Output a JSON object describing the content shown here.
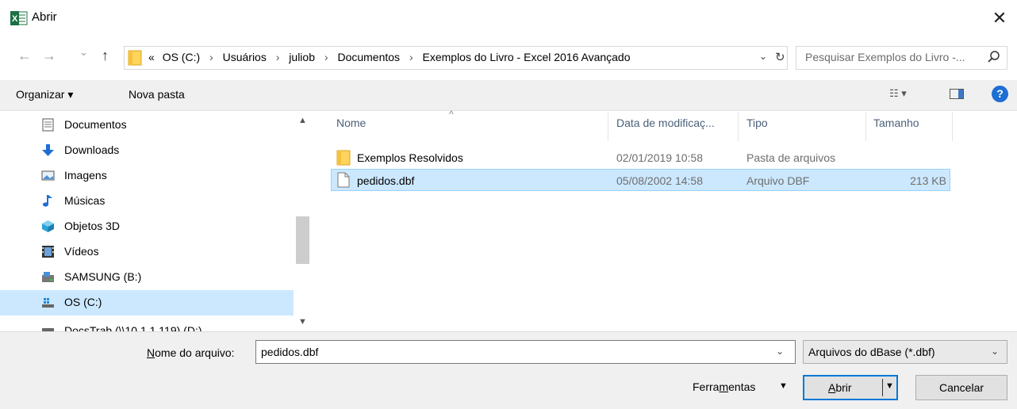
{
  "window": {
    "title": "Abrir",
    "close": "✕"
  },
  "nav": {
    "back": "←",
    "forward": "→",
    "recent": "⌄",
    "up": "↑"
  },
  "address": {
    "prefix": "«",
    "crumbs": [
      "OS (C:)",
      "Usuários",
      "juliob",
      "Documentos",
      "Exemplos do Livro - Excel 2016 Avançado"
    ],
    "separator": "›",
    "dropdown": "⌄",
    "refresh": "↻"
  },
  "search": {
    "placeholder": "Pesquisar Exemplos do Livro -..."
  },
  "toolbar": {
    "organize": "Organizar ▾",
    "new_folder": "Nova pasta",
    "view": "☷ ▾",
    "help": "?"
  },
  "sidebar": {
    "items": [
      {
        "label": "Documentos",
        "icon": "document-icon"
      },
      {
        "label": "Downloads",
        "icon": "download-icon"
      },
      {
        "label": "Imagens",
        "icon": "pictures-icon"
      },
      {
        "label": "Músicas",
        "icon": "music-icon"
      },
      {
        "label": "Objetos 3D",
        "icon": "cube-icon"
      },
      {
        "label": "Vídeos",
        "icon": "video-icon"
      },
      {
        "label": "SAMSUNG (B:)",
        "icon": "usb-drive-icon"
      },
      {
        "label": "OS (C:)",
        "icon": "windows-drive-icon",
        "selected": true
      },
      {
        "label": "DocsTrab (\\\\10.1.1.119) (D:)",
        "icon": "network-drive-icon"
      }
    ],
    "scroll_up": "▲",
    "scroll_down": "▼"
  },
  "files": {
    "columns": [
      "Nome",
      "Data de modificaç...",
      "Tipo",
      "Tamanho"
    ],
    "sort_indicator": "^",
    "rows": [
      {
        "name": "Exemplos Resolvidos",
        "modified": "02/01/2019 10:58",
        "type": "Pasta de arquivos",
        "size": "",
        "icon": "folder-icon",
        "selected": false
      },
      {
        "name": "pedidos.dbf",
        "modified": "05/08/2002 14:58",
        "type": "Arquivo DBF",
        "size": "213 KB",
        "icon": "file-icon",
        "selected": true
      }
    ]
  },
  "footer": {
    "filename_label_pre": "N",
    "filename_label_rest": "ome do arquivo:",
    "filename_value": "pedidos.dbf",
    "filetype_value": "Arquivos do dBase (*.dbf)",
    "tools_pre": "Ferra",
    "tools_ul": "m",
    "tools_post": "entas",
    "tools_dd": "▼",
    "open_ul": "A",
    "open_rest": "brir",
    "open_dd": "▼",
    "cancel": "Cancelar",
    "dropdown": "⌄"
  }
}
